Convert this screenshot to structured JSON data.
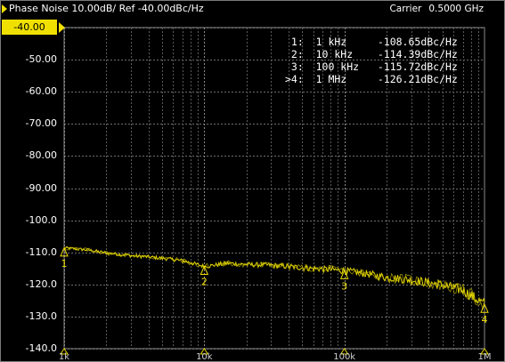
{
  "title": {
    "trace_label": "Phase Noise 10.00dB/ Ref -40.00dBc/Hz",
    "carrier_label": "Carrier",
    "carrier_value": "0.5000 GHz"
  },
  "y_axis": {
    "ref_label": "-40.00",
    "labels": [
      "-50.00",
      "-60.00",
      "-70.00",
      "-80.00",
      "-90.00",
      "-100.0",
      "-110.0",
      "-120.0",
      "-130.0",
      "-140.0"
    ]
  },
  "x_axis": {
    "ticks": [
      "1k",
      "10k",
      "100k",
      "1M"
    ]
  },
  "markers": [
    {
      "id": "1",
      "prefix": " ",
      "freq": "1 kHz",
      "value": "-108.65",
      "unit": "dBc/Hz"
    },
    {
      "id": "2",
      "prefix": " ",
      "freq": "10 kHz",
      "value": "-114.39",
      "unit": "dBc/Hz"
    },
    {
      "id": "3",
      "prefix": " ",
      "freq": "100 kHz",
      "value": "-115.72",
      "unit": "dBc/Hz"
    },
    {
      "id": "4",
      "prefix": ">",
      "freq": "1 MHz",
      "value": "-126.21",
      "unit": "dBc/Hz"
    }
  ],
  "chart_data": {
    "type": "line",
    "x_scale": "log",
    "xlim": [
      1000,
      1000000
    ],
    "ylim": [
      -140,
      -40
    ],
    "x_tick_labels": [
      "1k",
      "10k",
      "100k",
      "1M"
    ],
    "y_tick_labels": [
      "-40.00",
      "-50.00",
      "-60.00",
      "-70.00",
      "-80.00",
      "-90.00",
      "-100.0",
      "-110.0",
      "-120.0",
      "-130.0",
      "-140.0"
    ],
    "grid": true,
    "series": [
      {
        "color": "#e6d800",
        "x": [
          1000,
          1500,
          2000,
          3000,
          5000,
          7000,
          10000,
          15000,
          20000,
          30000,
          50000,
          70000,
          100000,
          150000,
          200000,
          300000,
          500000,
          700000,
          1000000
        ],
        "y": [
          -108.65,
          -109.3,
          -110.2,
          -111.0,
          -111.8,
          -112.6,
          -114.39,
          -113.4,
          -113.8,
          -114.0,
          -114.8,
          -115.2,
          -115.72,
          -116.8,
          -117.8,
          -118.6,
          -120.2,
          -121.8,
          -126.21
        ]
      }
    ],
    "marker_points": [
      {
        "label": "1",
        "x": 1000,
        "y": -108.65
      },
      {
        "label": "2",
        "x": 10000,
        "y": -114.39
      },
      {
        "label": "3",
        "x": 100000,
        "y": -115.72
      },
      {
        "label": "4",
        "x": 1000000,
        "y": -126.21
      }
    ]
  }
}
